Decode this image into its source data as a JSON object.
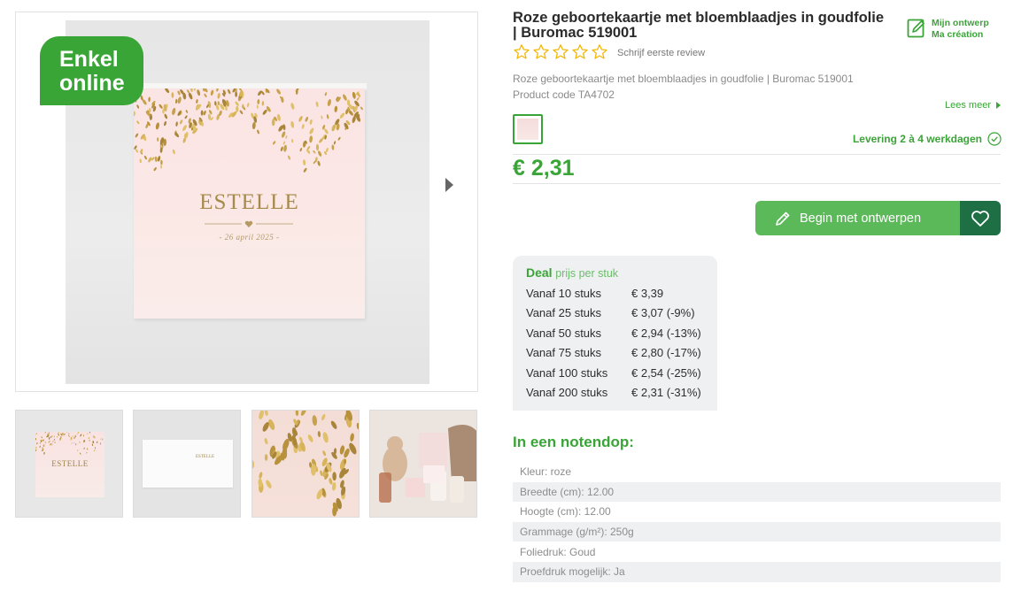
{
  "gallery": {
    "badge_line1": "Enkel",
    "badge_line2": "online",
    "card_name": "ESTELLE",
    "card_date": "- 26 april 2025 -",
    "thumb_card_name": "ESTELLE",
    "thumb_open_name": "ESTELLE"
  },
  "product": {
    "title": "Roze geboortekaartje met bloemblaadjes in goudfolie | Buromac 519001",
    "my_design_line1": "Mijn ontwerp",
    "my_design_line2": "Ma création",
    "review_link": "Schrijf eerste review",
    "description": "Roze geboortekaartje met bloemblaadjes in goudfolie | Buromac 519001",
    "product_code": "Product code TA4702",
    "read_more": "Lees meer",
    "delivery": "Levering 2 à 4 werkdagen",
    "price": "€ 2,31",
    "cta_label": "Begin met ontwerpen"
  },
  "deal": {
    "title": "Deal",
    "subtitle": "prijs per stuk",
    "rows": [
      {
        "qty": "Vanaf 10 stuks",
        "price": "€ 3,39"
      },
      {
        "qty": "Vanaf 25 stuks",
        "price": "€ 3,07 (-9%)"
      },
      {
        "qty": "Vanaf 50 stuks",
        "price": "€ 2,94 (-13%)"
      },
      {
        "qty": "Vanaf 75 stuks",
        "price": "€ 2,80 (-17%)"
      },
      {
        "qty": "Vanaf 100 stuks",
        "price": "€ 2,54 (-25%)"
      },
      {
        "qty": "Vanaf 200 stuks",
        "price": "€ 2,31 (-31%)"
      }
    ]
  },
  "nutshell": {
    "title": "In een notendop:",
    "specs": [
      "Kleur: roze",
      "Breedte (cm): 12.00",
      "Hoogte (cm): 12.00",
      "Grammage (g/m²): 250g",
      "Foliedruk: Goud",
      "Proefdruk mogelijk: Ja"
    ]
  },
  "colors": {
    "accent": "#3aa537",
    "cta": "#5cb95a",
    "favorite": "#1f6f45",
    "gold": "#a68a4c"
  },
  "icons": {
    "next": "chevron-right-icon",
    "my_design": "edit-document-icon",
    "rating": "star-outline-icon",
    "delivery": "check-circle-icon",
    "cta": "pencil-icon",
    "favorite": "heart-outline-icon"
  }
}
